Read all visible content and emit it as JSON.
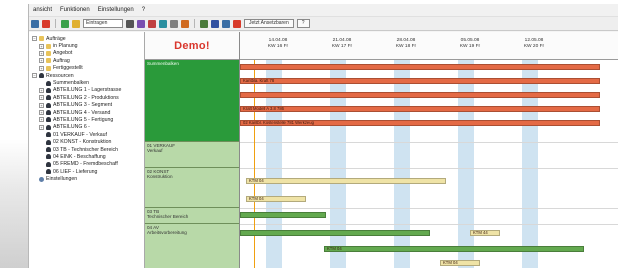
{
  "menu": [
    "ansicht",
    "Funktionen",
    "Einstellungen",
    "?"
  ],
  "toolbar": {
    "search_placeholder": "Eintragen",
    "today_button": "Jetzt Ansetzbaren",
    "help": "?",
    "icon_colors": [
      "#3a6ea5",
      "#d83a2a",
      "#3aa04a",
      "#e0b030",
      "#555555",
      "#7a4fb0",
      "#c04040",
      "#2a8fa0",
      "#808080",
      "#d06a20",
      "#4a7a3a",
      "#3050a0"
    ]
  },
  "tree": [
    {
      "label": "Aufträge",
      "indent": 0,
      "exp": "−",
      "icon": "folder"
    },
    {
      "label": "in Planung",
      "indent": 1,
      "exp": "+",
      "icon": "folder"
    },
    {
      "label": "Angebot",
      "indent": 1,
      "exp": "+",
      "icon": "folder"
    },
    {
      "label": "Auftrag",
      "indent": 1,
      "exp": "+",
      "icon": "folder"
    },
    {
      "label": "Fertiggestellt",
      "indent": 1,
      "exp": "+",
      "icon": "folder"
    },
    {
      "label": "Ressourcen",
      "indent": 0,
      "exp": "−",
      "icon": "person"
    },
    {
      "label": "Summenbalken",
      "indent": 1,
      "exp": "",
      "icon": "person"
    },
    {
      "label": "ABTEILUNG 1 - Lagerstrasse",
      "indent": 1,
      "exp": "+",
      "icon": "person"
    },
    {
      "label": "ABTEILUNG 2 - Produktions",
      "indent": 1,
      "exp": "+",
      "icon": "person"
    },
    {
      "label": "ABTEILUNG 3 - Segment",
      "indent": 1,
      "exp": "+",
      "icon": "person"
    },
    {
      "label": "ABTEILUNG 4 - Versand",
      "indent": 1,
      "exp": "+",
      "icon": "person"
    },
    {
      "label": "ABTEILUNG 5 - Fertigung",
      "indent": 1,
      "exp": "+",
      "icon": "person"
    },
    {
      "label": "ABTEILUNG 6 -",
      "indent": 1,
      "exp": "+",
      "icon": "person"
    },
    {
      "label": "01 VERKAUF - Verkauf",
      "indent": 1,
      "exp": "",
      "icon": "person"
    },
    {
      "label": "02 KONST - Konstruktion",
      "indent": 1,
      "exp": "",
      "icon": "person"
    },
    {
      "label": "03 TB - Technischer Bereich",
      "indent": 1,
      "exp": "",
      "icon": "person"
    },
    {
      "label": "04 EINK - Beschaffung",
      "indent": 1,
      "exp": "",
      "icon": "person"
    },
    {
      "label": "05 FREMD - Fremdbeschaff",
      "indent": 1,
      "exp": "",
      "icon": "person"
    },
    {
      "label": "06 LIEF - Lieferung",
      "indent": 1,
      "exp": "",
      "icon": "person"
    },
    {
      "label": "Einstellungen",
      "indent": 0,
      "exp": "",
      "icon": "gear"
    }
  ],
  "demo_label": "Demo!",
  "resources": [
    {
      "label": "Summenbalken",
      "style": "dark"
    },
    {
      "label": "01 VERKAUF\nVerkauf",
      "style": "light"
    },
    {
      "label": "02 KONST\nKonstruktion",
      "style": "light"
    },
    {
      "label": "03 TB\nTechnischer Bereich",
      "style": "light"
    },
    {
      "label": "04 AV\nArbeitsvorbereitung",
      "style": "light"
    }
  ],
  "dates": [
    {
      "date": "14.04.08",
      "week": "KW 16 Fr"
    },
    {
      "date": "21.04.08",
      "week": "KW 17 Fr"
    },
    {
      "date": "28.04.08",
      "week": "KW 18 Fr"
    },
    {
      "date": "05.05.08",
      "week": "KW 19 Fr"
    },
    {
      "date": "12.05.08",
      "week": "KW 20 Fr"
    }
  ],
  "bars": [
    {
      "color": "red",
      "label": ""
    },
    {
      "color": "red",
      "label": "Kantbla. Kraft 78"
    },
    {
      "color": "red",
      "label": ""
    },
    {
      "color": "red",
      "label": "Kraft Modell A 3.8 786"
    },
    {
      "color": "red",
      "label": "02 Kantbl. Kostenstelle 781 Werkzeug"
    },
    {
      "color": "tan",
      "label": "KTM 04"
    },
    {
      "color": "tan",
      "label": "KTM 04"
    },
    {
      "color": "green",
      "label": ""
    },
    {
      "color": "green",
      "label": ""
    },
    {
      "color": "tan",
      "label": "KTM 44"
    },
    {
      "color": "green",
      "label": "KTM 04"
    },
    {
      "color": "tan",
      "label": "KTM 04"
    }
  ]
}
